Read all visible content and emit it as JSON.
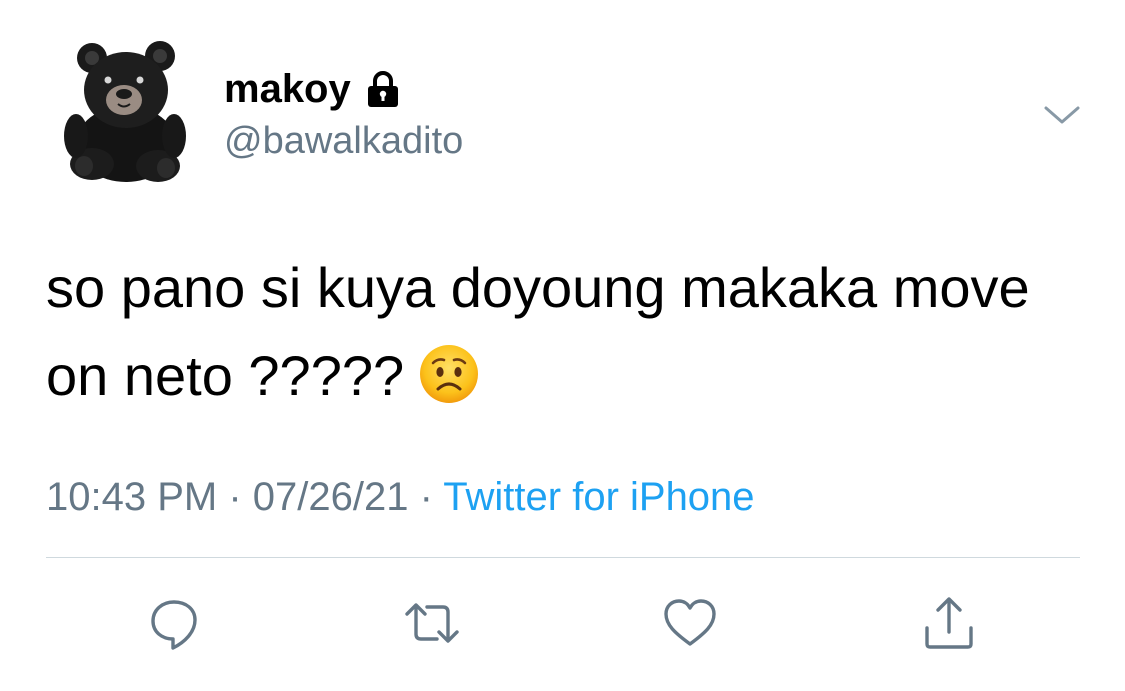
{
  "user": {
    "display_name": "makoy",
    "handle": "@bawalkadito",
    "protected_icon": "lock-icon",
    "avatar": "black-teddy-bear-avatar"
  },
  "menu": {
    "icon": "chevron-down-icon"
  },
  "tweet": {
    "text": "so pano si kuya doyoung makaka move on neto ?????",
    "emoji": "worried-face-emoji"
  },
  "meta": {
    "time": "10:43 PM",
    "separator": " · ",
    "date": "07/26/21",
    "source": "Twitter for iPhone"
  },
  "actions": [
    {
      "name": "reply",
      "icon": "reply-icon"
    },
    {
      "name": "retweet",
      "icon": "retweet-icon"
    },
    {
      "name": "like",
      "icon": "heart-icon"
    },
    {
      "name": "share",
      "icon": "share-icon"
    }
  ],
  "colors": {
    "secondary_text": "#657786",
    "link": "#1da1f2",
    "icon": "#657786",
    "divider": "#cfd9de"
  }
}
